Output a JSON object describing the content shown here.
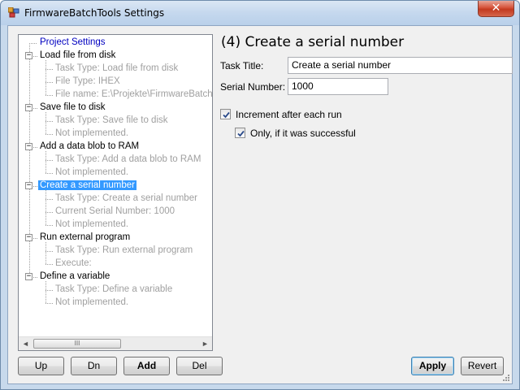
{
  "window": {
    "title": "FirmwareBatchTools Settings",
    "close_label": "✕"
  },
  "tree": {
    "root": "Project Settings",
    "tasks": [
      {
        "label": "Load file from disk",
        "children": [
          "Task Type: Load file from disk",
          "File Type: IHEX",
          "File name: E:\\Projekte\\FirmwareBatchTools"
        ]
      },
      {
        "label": "Save file to disk",
        "children": [
          "Task Type: Save file to disk",
          "Not implemented."
        ]
      },
      {
        "label": "Add a data blob to RAM",
        "children": [
          "Task Type: Add a data blob to RAM",
          "Not implemented."
        ]
      },
      {
        "label": "Create a serial number",
        "selected": true,
        "children": [
          "Task Type: Create a serial number",
          "Current Serial Number: 1000",
          "Not implemented."
        ]
      },
      {
        "label": "Run external program",
        "children": [
          "Task Type: Run external program",
          "Execute:"
        ]
      },
      {
        "label": "Define a variable",
        "children": [
          "Task Type: Define a variable",
          "Not implemented."
        ]
      }
    ],
    "scroll_left": "◄",
    "scroll_right": "►",
    "scroll_grip": "III"
  },
  "panel": {
    "heading": "(4) Create a serial number",
    "task_title_label": "Task Title:",
    "task_title_value": "Create a serial number",
    "serial_label": "Serial Number:",
    "serial_value": "1000",
    "increment_label": "Increment after each run",
    "increment_checked": true,
    "only_success_label": "Only, if it was successful",
    "only_success_checked": true
  },
  "buttons": {
    "up": "Up",
    "dn": "Dn",
    "add": "Add",
    "del": "Del",
    "apply": "Apply",
    "revert": "Revert"
  },
  "colors": {
    "selection": "#3399ff",
    "root_text": "#0000c0",
    "leaf_text": "#a0a0a0",
    "title_bar": "#c5d8ee",
    "close_button": "#d5523a"
  }
}
